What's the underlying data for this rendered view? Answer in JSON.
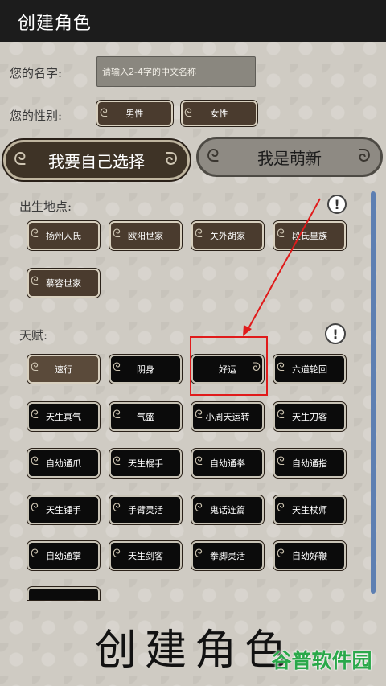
{
  "header": {
    "title": "创建角色"
  },
  "form": {
    "name_label": "您的名字:",
    "name_placeholder": "请输入2-4字的中文名称",
    "gender_label": "您的性别:",
    "gender_options": [
      "男性",
      "女性"
    ]
  },
  "mode_buttons": {
    "self_select": "我要自己选择",
    "newbie": "我是萌新"
  },
  "birthplace": {
    "label": "出生地点:",
    "options": [
      "扬州人氏",
      "欧阳世家",
      "关外胡家",
      "段氏皇族",
      "慕容世家"
    ]
  },
  "talent": {
    "label": "天赋:",
    "options": [
      "速行",
      "阴身",
      "好运",
      "六道轮回",
      "天生真气",
      "气盛",
      "小周天运转",
      "天生刀客",
      "自幼通爪",
      "天生棍手",
      "自幼通拳",
      "自幼通指",
      "天生锤手",
      "手臂灵活",
      "鬼话连篇",
      "天生杖师",
      "自幼通掌",
      "天生剑客",
      "拳脚灵活",
      "自幼好鞭"
    ]
  },
  "info_icon_glyph": "!",
  "footer": {
    "brush_title": "创建角色",
    "watermark": "谷普软件园"
  },
  "colors": {
    "accent_red": "#e01b1b",
    "scrollbar": "#5d7fb2",
    "watermark_green": "#2aa84a"
  }
}
